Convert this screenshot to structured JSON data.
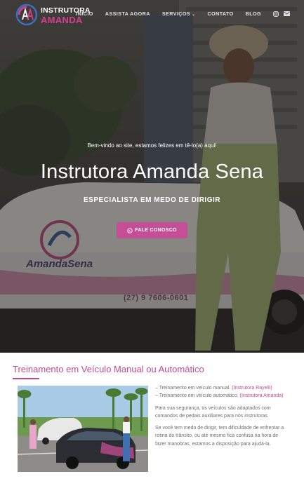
{
  "logo": {
    "line1": "INSTRUTORA",
    "line2": "AMANDA"
  },
  "nav": {
    "items": [
      "INÍCIO",
      "ASSISTA AGORA",
      "SERVIÇOS",
      "CONTATO",
      "BLOG"
    ]
  },
  "hero": {
    "welcome": "Bem-vindo ao site, estamos felizes em tê-lo(a) aqui!",
    "title": "Instrutora Amanda Sena",
    "subtitle": "ESPECIALISTA EM MEDO DE DIRIGIR",
    "cta_label": "FALE CONOSCO",
    "car_brand": "AmandaSena",
    "car_phone": "(27) 9 7606-0601"
  },
  "section": {
    "title": "Treinamento em Veículo Manual ou Automático",
    "item1": "– Treinamento em veículo manual.",
    "item1_note": "(Instrutora Rayelli)",
    "item2": "– Treinamento em veículo automático.",
    "item2_note": "(Instrutora Amanda)",
    "para1": "Para sua segurança, os veículos são adaptados com comandos de pedais auxiliares para nós instrutoras.",
    "para2": "Se você tem medo de dirigir, tem dificuldade de enfrentar a rotina do trânsito, ou até mesmo fica confusa na hora de fazer manobras, estamos a disposição para ajudá-la."
  },
  "colors": {
    "accent": "#c4488f",
    "cta": "#c64e96",
    "body_text": "#6e6e6e"
  },
  "icons": [
    "logo-mark-icon",
    "chevron-down-icon",
    "instagram-icon",
    "envelope-icon",
    "whatsapp-icon"
  ]
}
